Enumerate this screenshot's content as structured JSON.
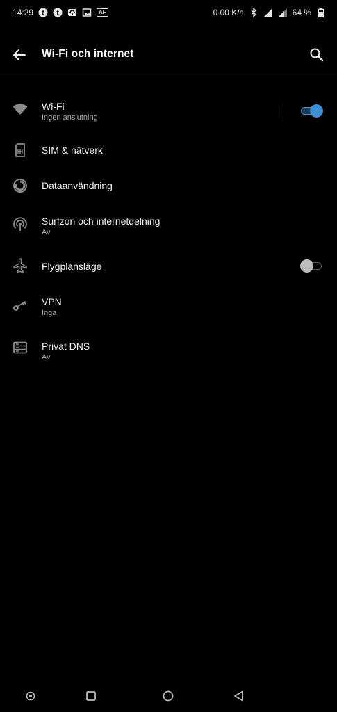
{
  "status_bar": {
    "time": "14:29",
    "speed": "0.00 K/s",
    "battery": "64 %",
    "notification_icons": [
      "t-icon",
      "t-icon",
      "wifi-calling-icon",
      "image-icon",
      "af-icon"
    ],
    "af_tag": "AF"
  },
  "app_bar": {
    "title": "Wi-Fi och internet"
  },
  "items": [
    {
      "icon": "wifi-icon",
      "label": "Wi-Fi",
      "summary": "Ingen anslutning",
      "toggle": "on"
    },
    {
      "icon": "sim-card-icon",
      "label": "SIM & nätverk",
      "summary": ""
    },
    {
      "icon": "data-usage-icon",
      "label": "Dataanvändning",
      "summary": ""
    },
    {
      "icon": "hotspot-icon",
      "label": "Surfzon och internetdelning",
      "summary": "Av"
    },
    {
      "icon": "airplane-icon",
      "label": "Flygplansläge",
      "summary": "",
      "toggle": "off"
    },
    {
      "icon": "vpn-key-icon",
      "label": "VPN",
      "summary": "Inga"
    },
    {
      "icon": "dns-icon",
      "label": "Privat DNS",
      "summary": "Av"
    }
  ],
  "colors": {
    "accent": "#3b8fd9",
    "background": "#000000",
    "text_primary": "#f2f2f2",
    "text_secondary": "#a6a6a6"
  }
}
